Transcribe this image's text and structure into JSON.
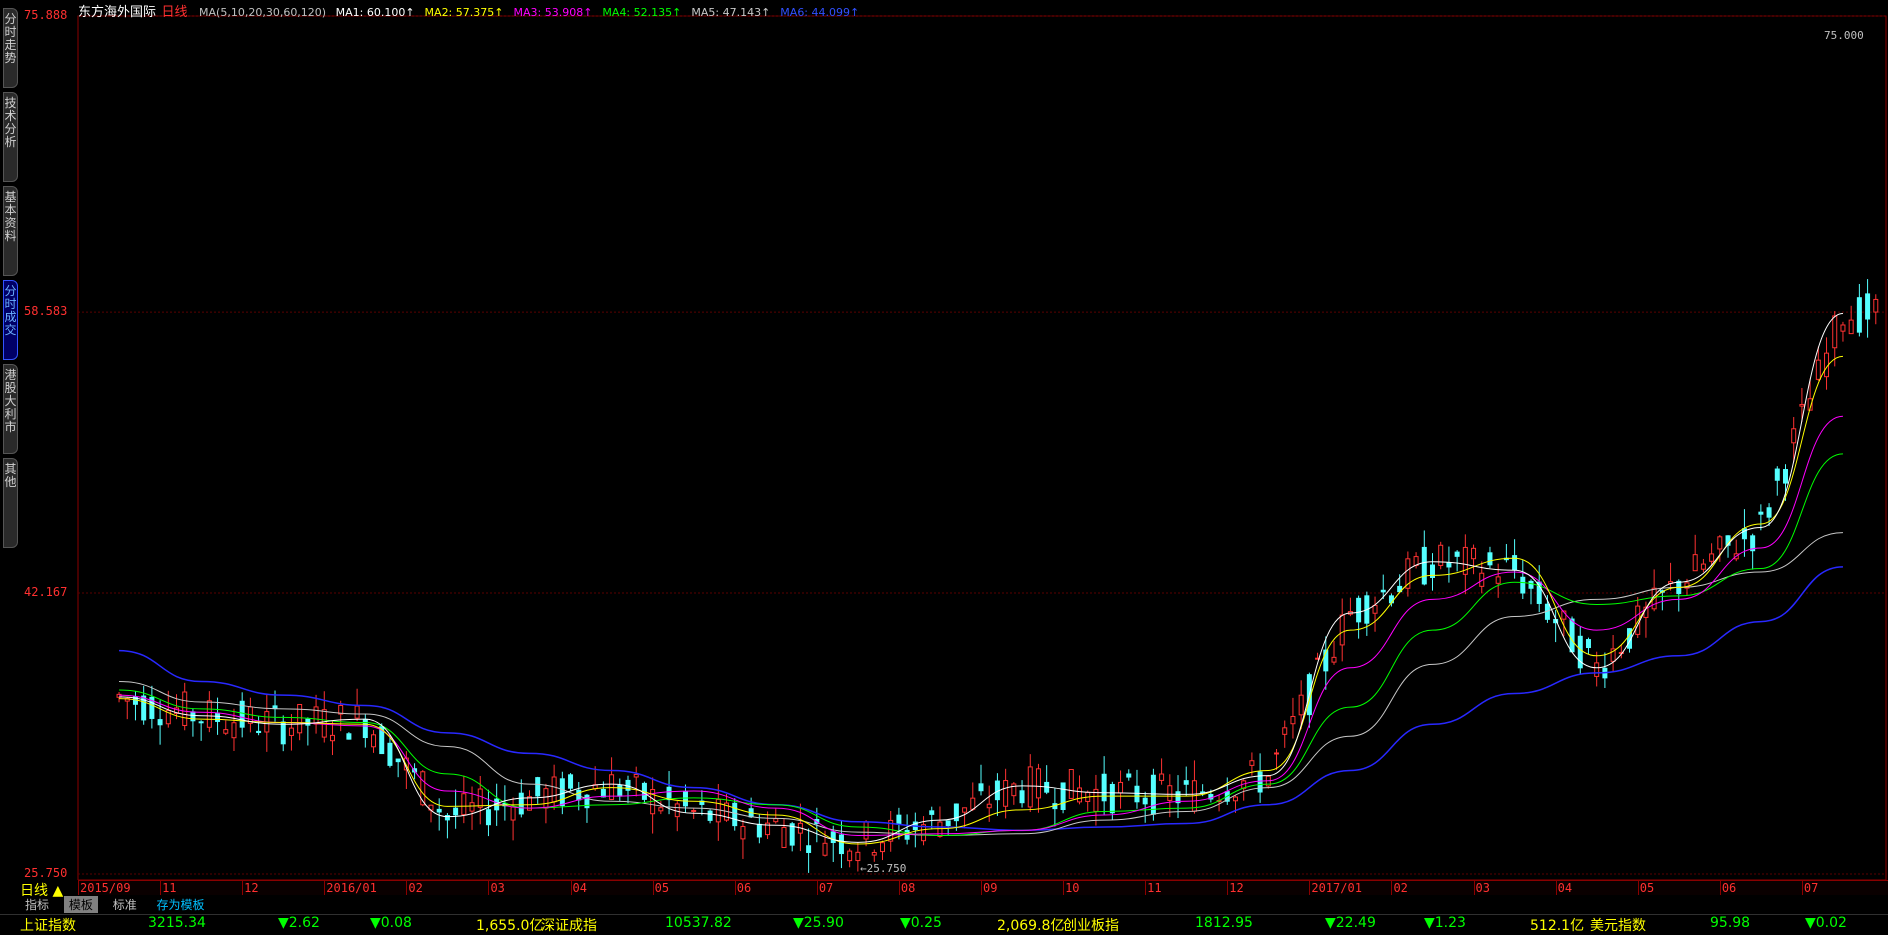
{
  "stock": {
    "name": "东方海外国际",
    "period_label": "日线"
  },
  "ma_header": {
    "params": "MA(5,10,20,30,60,120)",
    "items": [
      {
        "label": "MA1:",
        "value": "60.100↑",
        "color": "#ffffff"
      },
      {
        "label": "MA2:",
        "value": "57.375↑",
        "color": "#ffff00"
      },
      {
        "label": "MA3:",
        "value": "53.908↑",
        "color": "#ff00ff"
      },
      {
        "label": "MA4:",
        "value": "52.135↑",
        "color": "#00ff00"
      },
      {
        "label": "MA5:",
        "value": "47.143↑",
        "color": "#c8c8c8"
      },
      {
        "label": "MA6:",
        "value": "44.099↑",
        "color": "#3050ff"
      }
    ]
  },
  "sidebar": {
    "tabs": [
      {
        "label": "分时走势",
        "active": false
      },
      {
        "label": "技术分析",
        "active": false
      },
      {
        "label": "基本资料",
        "active": false
      },
      {
        "label": "分时成交",
        "active": true
      },
      {
        "label": "港股大利市",
        "active": false
      },
      {
        "label": "其他",
        "active": false
      }
    ]
  },
  "price_axis": {
    "labels": [
      "75.888",
      "58.583",
      "42.167",
      "25.750"
    ],
    "max_marker": "75.000",
    "min_marker": "25.750",
    "color": "#ff3030"
  },
  "time_axis": {
    "labels": [
      "2015/09",
      "11",
      "12",
      "2016/01",
      "02",
      "03",
      "04",
      "05",
      "06",
      "07",
      "08",
      "09",
      "10",
      "11",
      "12",
      "2017/01",
      "02",
      "03",
      "04",
      "05",
      "06",
      "07"
    ]
  },
  "chart_data": {
    "type": "line",
    "title": "",
    "ylim": [
      25.75,
      75.888
    ],
    "x": [
      "2015/09",
      "11",
      "12",
      "2016/01",
      "02",
      "03",
      "04",
      "05",
      "06",
      "07",
      "08",
      "09",
      "10",
      "11",
      "12",
      "2017/01",
      "02",
      "03",
      "04",
      "05",
      "06",
      "07"
    ],
    "series": [
      {
        "name": "MA6",
        "color": "#2828ff",
        "values": [
          38.8,
          37.0,
          36.2,
          35.6,
          34.0,
          32.8,
          31.8,
          30.8,
          29.8,
          28.8,
          28.5,
          28.3,
          28.5,
          28.7,
          29.8,
          31.8,
          34.5,
          36.3,
          37.5,
          38.5,
          40.5,
          43.7
        ]
      },
      {
        "name": "MA5",
        "color": "#c8c8c8",
        "values": [
          37.0,
          35.8,
          35.4,
          35.1,
          33.2,
          31.0,
          30.0,
          29.6,
          29.0,
          28.2,
          28.0,
          28.1,
          28.9,
          29.4,
          30.8,
          33.8,
          38.0,
          40.8,
          41.8,
          42.5,
          43.4,
          45.7
        ]
      },
      {
        "name": "MA4",
        "color": "#00ff00",
        "values": [
          36.5,
          35.4,
          34.9,
          34.6,
          31.6,
          29.6,
          29.8,
          30.2,
          29.8,
          28.5,
          28.0,
          28.3,
          29.4,
          29.6,
          31.0,
          35.5,
          40.0,
          42.8,
          41.5,
          42.0,
          43.6,
          50.3
        ]
      },
      {
        "name": "MA3",
        "color": "#ff00ff",
        "values": [
          36.2,
          35.2,
          34.6,
          34.4,
          30.6,
          29.6,
          30.3,
          30.6,
          29.6,
          28.0,
          28.1,
          28.3,
          29.2,
          30.0,
          31.2,
          37.8,
          41.8,
          43.4,
          40.0,
          41.8,
          44.8,
          52.5
        ]
      },
      {
        "name": "MA2",
        "color": "#ffff00",
        "values": [
          36.0,
          34.8,
          34.6,
          34.5,
          29.7,
          29.8,
          30.8,
          30.0,
          29.2,
          27.5,
          28.4,
          29.5,
          30.3,
          30.3,
          31.8,
          40.0,
          43.2,
          44.2,
          38.5,
          42.5,
          46.2,
          56.0
        ]
      },
      {
        "name": "MA1",
        "color": "#ffffff",
        "values": [
          36.1,
          35.0,
          34.5,
          34.8,
          29.1,
          30.2,
          31.0,
          29.3,
          28.6,
          27.6,
          28.9,
          30.9,
          30.5,
          30.4,
          31.5,
          41.0,
          44.0,
          43.5,
          37.8,
          42.8,
          46.0,
          58.5
        ]
      }
    ]
  },
  "toolbar": {
    "period": "日线",
    "tabs": [
      "指标",
      "模板",
      "标准",
      "存为模板"
    ]
  },
  "ticker": {
    "items": [
      {
        "text": "上证指数",
        "color": "#ffff00"
      },
      {
        "text": "3215.34",
        "color": "#00ff00"
      },
      {
        "text": "▼2.62",
        "color": "#00ff00"
      },
      {
        "text": "▼0.08",
        "color": "#00ff00"
      },
      {
        "text": "1,655.0亿",
        "color": "#ffff00"
      },
      {
        "text": "深证成指",
        "color": "#ffff00"
      },
      {
        "text": "10537.82",
        "color": "#00ff00"
      },
      {
        "text": "▼25.90",
        "color": "#00ff00"
      },
      {
        "text": "▼0.25",
        "color": "#00ff00"
      },
      {
        "text": "2,069.8亿",
        "color": "#ffff00"
      },
      {
        "text": "创业板指",
        "color": "#ffff00"
      },
      {
        "text": "1812.95",
        "color": "#00ff00"
      },
      {
        "text": "▼22.49",
        "color": "#00ff00"
      },
      {
        "text": "▼1.23",
        "color": "#00ff00"
      },
      {
        "text": "512.1亿",
        "color": "#ffff00"
      },
      {
        "text": "美元指数",
        "color": "#ffff00"
      },
      {
        "text": "95.98",
        "color": "#00ff00"
      },
      {
        "text": "▼0.02",
        "color": "#00ff00"
      }
    ]
  }
}
